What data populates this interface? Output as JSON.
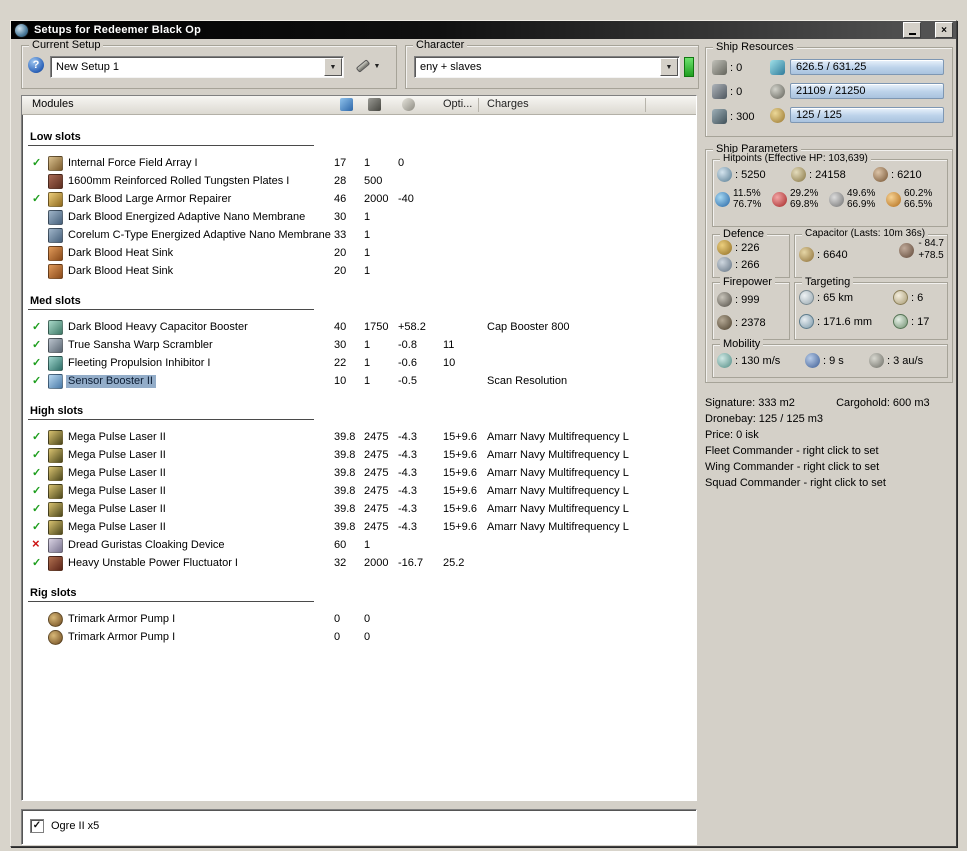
{
  "window": {
    "title": "Setups for Redeemer Black Op"
  },
  "setup": {
    "group_label": "Current Setup",
    "value": "New Setup 1"
  },
  "character": {
    "group_label": "Character",
    "value": "eny + slaves"
  },
  "modules": {
    "header": {
      "title": "Modules",
      "opti": "Opti...",
      "charges": "Charges"
    },
    "sections": [
      {
        "name": "Low slots",
        "rows": [
          {
            "state": "ok",
            "icon": "field-array",
            "name": "Internal Force Field Array I",
            "cpu": "17",
            "pg": "1",
            "cap": "0",
            "opti": "",
            "charge": ""
          },
          {
            "state": "",
            "icon": "armor-plate",
            "name": "1600mm Reinforced Rolled Tungsten Plates I",
            "cpu": "28",
            "pg": "500",
            "cap": "",
            "opti": "",
            "charge": ""
          },
          {
            "state": "ok",
            "icon": "armor-repairer",
            "name": "Dark Blood Large Armor Repairer",
            "cpu": "46",
            "pg": "2000",
            "cap": "-40",
            "opti": "",
            "charge": ""
          },
          {
            "state": "",
            "icon": "nano-membrane",
            "name": "Dark Blood Energized Adaptive Nano Membrane",
            "cpu": "30",
            "pg": "1",
            "cap": "",
            "opti": "",
            "charge": ""
          },
          {
            "state": "",
            "icon": "nano-membrane",
            "name": "Corelum C-Type Energized Adaptive Nano Membrane",
            "cpu": "33",
            "pg": "1",
            "cap": "",
            "opti": "",
            "charge": ""
          },
          {
            "state": "",
            "icon": "heat-sink",
            "name": "Dark Blood Heat Sink",
            "cpu": "20",
            "pg": "1",
            "cap": "",
            "opti": "",
            "charge": ""
          },
          {
            "state": "",
            "icon": "heat-sink",
            "name": "Dark Blood Heat Sink",
            "cpu": "20",
            "pg": "1",
            "cap": "",
            "opti": "",
            "charge": ""
          }
        ]
      },
      {
        "name": "Med slots",
        "rows": [
          {
            "state": "ok",
            "icon": "cap-booster",
            "name": "Dark Blood Heavy Capacitor Booster",
            "cpu": "40",
            "pg": "1750",
            "cap": "+58.2",
            "opti": "",
            "charge": "Cap Booster 800"
          },
          {
            "state": "ok",
            "icon": "warp-scrambler",
            "name": "True Sansha Warp Scrambler",
            "cpu": "30",
            "pg": "1",
            "cap": "-0.8",
            "opti": "11",
            "charge": ""
          },
          {
            "state": "ok",
            "icon": "web",
            "name": "Fleeting Propulsion Inhibitor I",
            "cpu": "22",
            "pg": "1",
            "cap": "-0.6",
            "opti": "10",
            "charge": ""
          },
          {
            "state": "ok",
            "icon": "sensor-booster",
            "name": "Sensor Booster II",
            "cpu": "10",
            "pg": "1",
            "cap": "-0.5",
            "opti": "",
            "charge": "Scan Resolution",
            "selected": true
          }
        ]
      },
      {
        "name": "High slots",
        "rows": [
          {
            "state": "ok",
            "icon": "pulse-laser",
            "name": "Mega Pulse Laser II",
            "cpu": "39.8",
            "pg": "2475",
            "cap": "-4.3",
            "opti": "15+9.6",
            "charge": "Amarr Navy Multifrequency L"
          },
          {
            "state": "ok",
            "icon": "pulse-laser",
            "name": "Mega Pulse Laser II",
            "cpu": "39.8",
            "pg": "2475",
            "cap": "-4.3",
            "opti": "15+9.6",
            "charge": "Amarr Navy Multifrequency L"
          },
          {
            "state": "ok",
            "icon": "pulse-laser",
            "name": "Mega Pulse Laser II",
            "cpu": "39.8",
            "pg": "2475",
            "cap": "-4.3",
            "opti": "15+9.6",
            "charge": "Amarr Navy Multifrequency L"
          },
          {
            "state": "ok",
            "icon": "pulse-laser",
            "name": "Mega Pulse Laser II",
            "cpu": "39.8",
            "pg": "2475",
            "cap": "-4.3",
            "opti": "15+9.6",
            "charge": "Amarr Navy Multifrequency L"
          },
          {
            "state": "ok",
            "icon": "pulse-laser",
            "name": "Mega Pulse Laser II",
            "cpu": "39.8",
            "pg": "2475",
            "cap": "-4.3",
            "opti": "15+9.6",
            "charge": "Amarr Navy Multifrequency L"
          },
          {
            "state": "ok",
            "icon": "pulse-laser",
            "name": "Mega Pulse Laser II",
            "cpu": "39.8",
            "pg": "2475",
            "cap": "-4.3",
            "opti": "15+9.6",
            "charge": "Amarr Navy Multifrequency L"
          },
          {
            "state": "off",
            "icon": "cloak",
            "name": "Dread Guristas Cloaking Device",
            "cpu": "60",
            "pg": "1",
            "cap": "",
            "opti": "",
            "charge": ""
          },
          {
            "state": "ok",
            "icon": "neut",
            "name": "Heavy Unstable Power Fluctuator I",
            "cpu": "32",
            "pg": "2000",
            "cap": "-16.7",
            "opti": "25.2",
            "charge": ""
          }
        ]
      },
      {
        "name": "Rig slots",
        "rows": [
          {
            "state": "",
            "icon": "rig",
            "name": "Trimark Armor Pump I",
            "cpu": "0",
            "pg": "0",
            "cap": "",
            "opti": "",
            "charge": ""
          },
          {
            "state": "",
            "icon": "rig",
            "name": "Trimark Armor Pump I",
            "cpu": "0",
            "pg": "0",
            "cap": "",
            "opti": "",
            "charge": ""
          }
        ]
      }
    ]
  },
  "resources": {
    "group_label": "Ship Resources",
    "turrets": "0",
    "launchers": "0",
    "calibration": "300",
    "cpu": "626.5 / 631.25",
    "powergrid": "21109 / 21250",
    "drone": "125 / 125"
  },
  "parameters": {
    "group_label": "Ship Parameters",
    "hitpoints": {
      "label": "Hitpoints (Effective HP: 103,639)",
      "shield": "5250",
      "armor": "24158",
      "hull": "6210",
      "resists": [
        {
          "top": "11.5%",
          "bottom": "76.7%"
        },
        {
          "top": "29.2%",
          "bottom": "69.8%"
        },
        {
          "top": "49.6%",
          "bottom": "66.9%"
        },
        {
          "top": "60.2%",
          "bottom": "66.5%"
        }
      ]
    },
    "defence": {
      "label": "Defence",
      "v1": "226",
      "v2": "266"
    },
    "capacitor": {
      "label": "Capacitor (Lasts: 10m 36s)",
      "amount": "6640",
      "drain": "- 84.7",
      "recharge": "+78.5"
    },
    "firepower": {
      "label": "Firepower",
      "dps": "999",
      "volley": "2378"
    },
    "targeting": {
      "label": "Targeting",
      "range": "65 km",
      "max_targets": "6",
      "scan_res": "171.6 mm",
      "sensor_strength": "17"
    },
    "mobility": {
      "label": "Mobility",
      "speed": "130 m/s",
      "align": "9 s",
      "warp": "3 au/s"
    }
  },
  "info": {
    "signature": "Signature: 333 m2",
    "cargohold": "Cargohold: 600 m3",
    "dronebay": "Dronebay: 125 / 125 m3",
    "price": "Price: 0 isk",
    "fleet": "Fleet Commander - right click to set",
    "wing": "Wing Commander - right click to set",
    "squad": "Squad Commander - right click to set"
  },
  "drones": {
    "items": [
      {
        "checked": true,
        "name": "Ogre II x5"
      }
    ]
  }
}
